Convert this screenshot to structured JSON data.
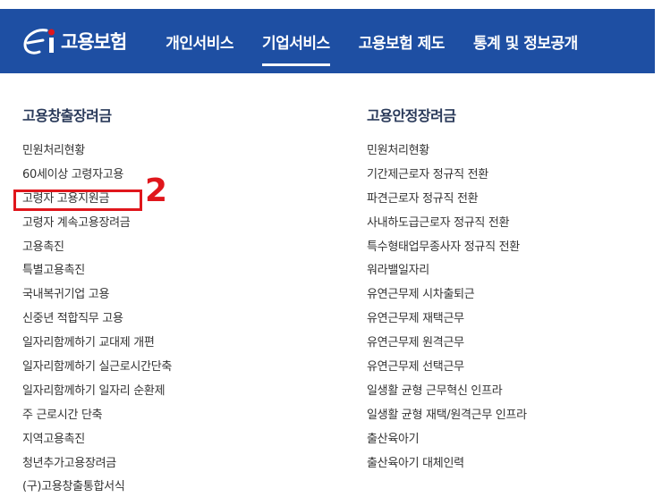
{
  "header": {
    "logo_text": "고용보험",
    "nav": [
      {
        "label": "개인서비스",
        "active": false
      },
      {
        "label": "기업서비스",
        "active": true
      },
      {
        "label": "고용보험 제도",
        "active": false
      },
      {
        "label": "통계 및 정보공개",
        "active": false
      }
    ]
  },
  "left": {
    "title": "고용창출장려금",
    "items": [
      "민원처리현황",
      "60세이상 고령자고용",
      "고령자 고용지원금",
      "고령자 계속고용장려금",
      "고용촉진",
      "특별고용촉진",
      "국내복귀기업 고용",
      "신중년 적합직무 고용",
      "일자리함께하기 교대제 개편",
      "일자리함께하기 실근로시간단축",
      "일자리함께하기 일자리 순환제",
      "주 근로시간 단축",
      "지역고용촉진",
      "청년추가고용장려금",
      "(구)고용창출통합서식"
    ]
  },
  "right": {
    "title": "고용안정장려금",
    "items": [
      "민원처리현황",
      "기간제근로자 정규직 전환",
      "파견근로자 정규직 전환",
      "사내하도급근로자 정규직 전환",
      "특수형태업무종사자 정규직 전환",
      "워라밸일자리",
      "유연근무제 시차출퇴근",
      "유연근무제 재택근무",
      "유연근무제 원격근무",
      "유연근무제 선택근무",
      "일생활 균형 근무혁신 인프라",
      "일생활 균형 재택/원격근무 인프라",
      "출산육아기",
      "출산육아기 대체인력"
    ]
  },
  "annotation": {
    "number": "2",
    "color": "#e0161c"
  },
  "colors": {
    "header_bg": "#1e4fa3",
    "highlight": "#e0161c"
  }
}
